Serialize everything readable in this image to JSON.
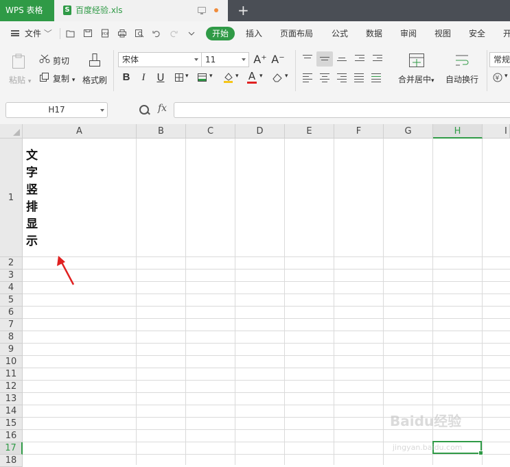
{
  "titlebar": {
    "app_label": "WPS 表格",
    "doc_name": "百度经验.xls",
    "xls_icon_letter": "S",
    "new_tab": "+"
  },
  "menu": {
    "file": "文件",
    "tabs": [
      "开始",
      "插入",
      "页面布局",
      "公式",
      "数据",
      "审阅",
      "视图",
      "安全",
      "开"
    ]
  },
  "ribbon": {
    "paste": "粘贴",
    "cut": "剪切",
    "copy": "复制",
    "format_painter": "格式刷",
    "font_name": "宋体",
    "font_size": "11",
    "merge_center": "合并居中",
    "wrap_text": "自动换行",
    "number_format": "常规",
    "bold": "B",
    "italic": "I",
    "underline": "U",
    "grow_font": "A⁺",
    "shrink_font": "A⁻",
    "font_color_letter": "A"
  },
  "formula": {
    "cell_ref": "H17",
    "fx": "fx",
    "content": ""
  },
  "grid": {
    "columns": [
      "A",
      "B",
      "C",
      "D",
      "E",
      "F",
      "G",
      "H",
      "I"
    ],
    "selected_column": "H",
    "rows": [
      "1",
      "2",
      "3",
      "4",
      "5",
      "6",
      "7",
      "8",
      "9",
      "10",
      "11",
      "12",
      "13",
      "14",
      "15",
      "16",
      "17",
      "18"
    ],
    "selected_row": "17",
    "a1_chars": [
      "文",
      "字",
      "竖",
      "排",
      "显",
      "示"
    ]
  },
  "watermark": {
    "main": "Baidu经验",
    "sub": "jingyan.baidu.com"
  },
  "colors": {
    "accent": "#2f9a46",
    "arrow": "#e02020"
  }
}
